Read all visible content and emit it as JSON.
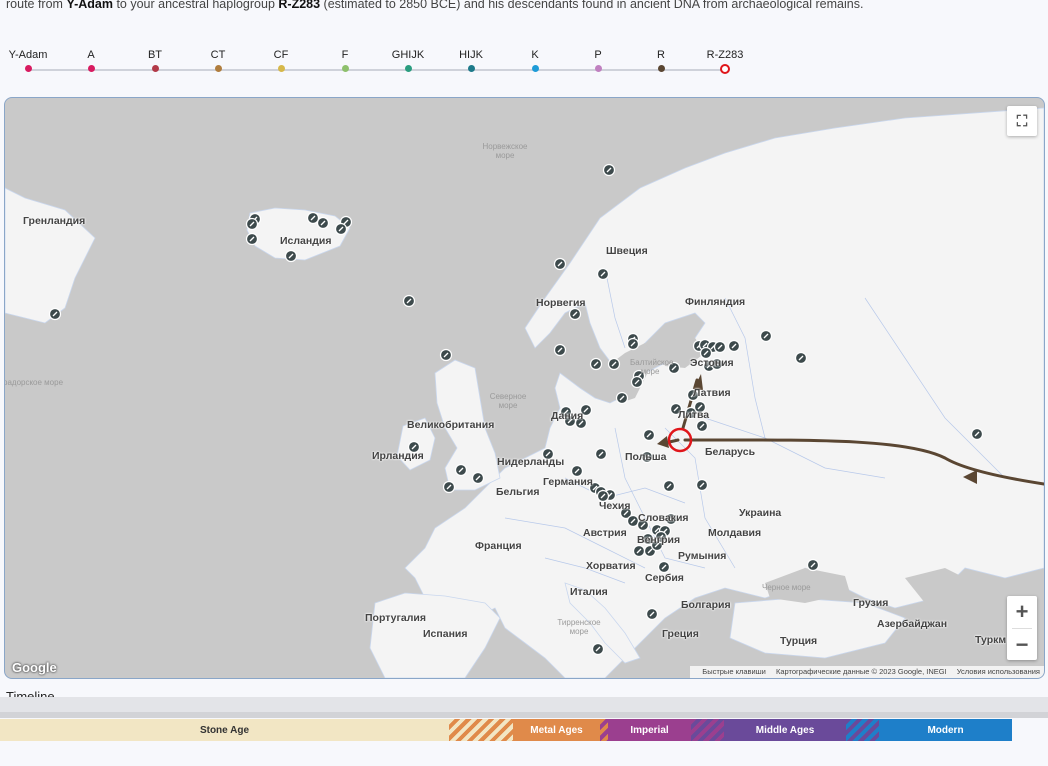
{
  "intro": {
    "prefix": "route from ",
    "origin": "Y-Adam",
    "mid1": " to your ancestral haplogroup ",
    "target": "R-Z283",
    "suffix": " (estimated to 2850 BCE) and his descendants found in ancient DNA from archaeological remains."
  },
  "haplogroups": [
    {
      "label": "Y-Adam",
      "color": "#d81b60"
    },
    {
      "label": "A",
      "color": "#d81b60"
    },
    {
      "label": "BT",
      "color": "#b23a48"
    },
    {
      "label": "CT",
      "color": "#b07d3d"
    },
    {
      "label": "CF",
      "color": "#d6b84a"
    },
    {
      "label": "F",
      "color": "#8ec06c"
    },
    {
      "label": "GHIJK",
      "color": "#2a9d7f"
    },
    {
      "label": "HIJK",
      "color": "#1d7a8a"
    },
    {
      "label": "K",
      "color": "#1e9bd7"
    },
    {
      "label": "P",
      "color": "#c080c0"
    },
    {
      "label": "R",
      "color": "#5a4632"
    },
    {
      "label": "R-Z283",
      "color": "#e0161b",
      "current": true
    }
  ],
  "map": {
    "countries": {
      "greenland": "Гренландия",
      "iceland": "Исландия",
      "sweden": "Швеция",
      "norway": "Норвегия",
      "finland": "Финляндия",
      "estonia": "Эстония",
      "latvia": "Латвия",
      "lithuania": "Литва",
      "denmark": "Дания",
      "uk": "Великобритания",
      "ireland": "Ирландия",
      "netherlands": "Нидерланды",
      "germany": "Германия",
      "belgium": "Бельгия",
      "poland": "Польша",
      "belarus": "Беларусь",
      "czech": "Чехия",
      "slovakia": "Словакия",
      "austria": "Австрия",
      "hungary": "Венгрия",
      "ukraine": "Украина",
      "moldova": "Молдавия",
      "romania": "Румыния",
      "france": "Франция",
      "croatia": "Хорватия",
      "serbia": "Сербия",
      "italy": "Италия",
      "bulgaria": "Болгария",
      "portugal": "Португалия",
      "spain": "Испания",
      "greece": "Греция",
      "turkey": "Турция",
      "georgia": "Грузия",
      "azerbaijan": "Азербайджан",
      "turkmenistan": "Туркм",
      "labrador": "радорское море"
    },
    "seas": {
      "norwegian": "Норвежское море",
      "baltic": "Балтийское море",
      "north": "Северное море",
      "black": "Черное море",
      "tyrrhenian": "Тирренское море"
    },
    "logo": "Google",
    "attribution": {
      "shortcuts": "Быстрые клавиши",
      "data": "Картографические данные © 2023 Google, INEGI",
      "terms": "Условия использования"
    },
    "route_color": "#5a4632",
    "highlight_color": "#e0161b"
  },
  "timeline_heading": "Timeline",
  "ages": [
    {
      "label": "Stone Age",
      "color": "#f2e6c4",
      "text_color": "#333"
    },
    {
      "label": "Metal Ages",
      "color": "#e08a4a",
      "text_color": "#fff"
    },
    {
      "label": "Imperial",
      "color": "#9b3f8f",
      "text_color": "#fff"
    },
    {
      "label": "Middle Ages",
      "color": "#6a4a9a",
      "text_color": "#fff"
    },
    {
      "label": "Modern",
      "color": "#1e7fc9",
      "text_color": "#fff"
    }
  ]
}
